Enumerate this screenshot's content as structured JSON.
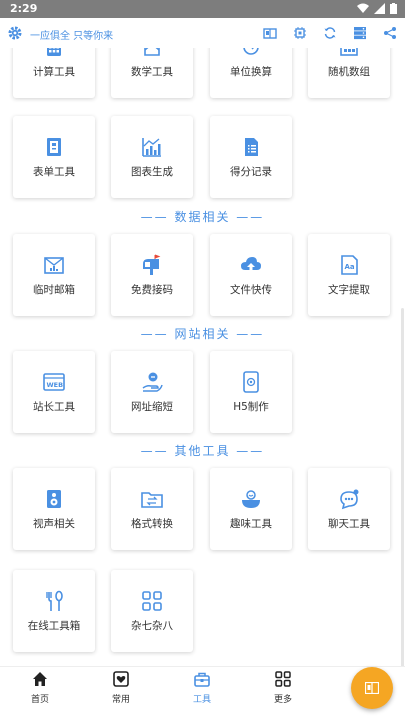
{
  "statusbar": {
    "time": "2:29"
  },
  "topbar": {
    "title": "一应俱全 只等你来"
  },
  "sections": {
    "data": "—— 数据相关 ——",
    "web": "—— 网站相关 ——",
    "other": "—— 其他工具 ——"
  },
  "tools": {
    "calc": "计算工具",
    "math": "数学工具",
    "unit": "单位换算",
    "random": "随机数组",
    "form": "表单工具",
    "chart": "图表生成",
    "score": "得分记录",
    "mail": "临时邮箱",
    "sms": "免费接码",
    "file": "文件快传",
    "text": "文字提取",
    "webmaster": "站长工具",
    "shorturl": "网址缩短",
    "h5": "H5制作",
    "av": "视声相关",
    "convert": "格式转换",
    "fun": "趣味工具",
    "chat": "聊天工具",
    "toolbox": "在线工具箱",
    "misc": "杂七杂八"
  },
  "tabs": [
    {
      "label": "首页"
    },
    {
      "label": "常用"
    },
    {
      "label": "工具"
    },
    {
      "label": "更多"
    }
  ],
  "colors": {
    "accent": "#4a90e2",
    "fab": "#f5a623",
    "statusbar": "#7d7d7d"
  }
}
